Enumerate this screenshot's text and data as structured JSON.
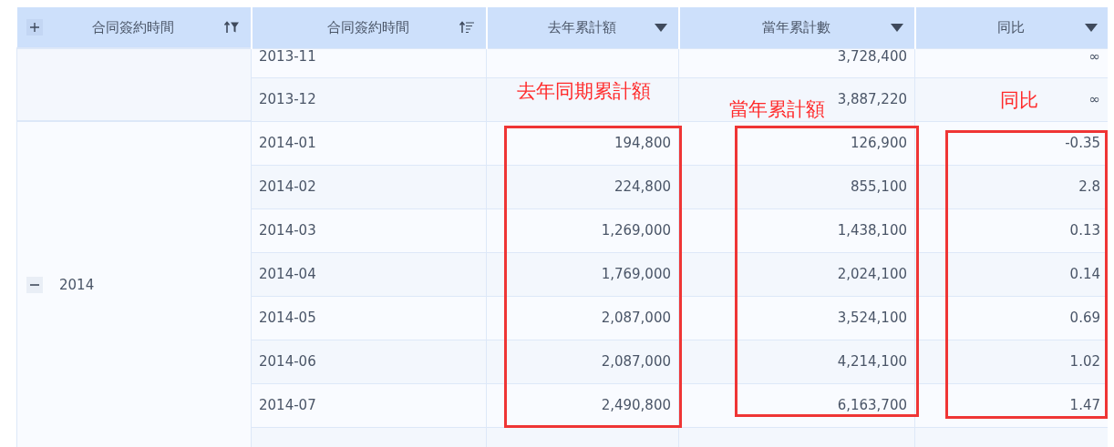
{
  "header": {
    "columns": [
      {
        "label": "合同簽約時間",
        "kind": "sort-filter"
      },
      {
        "label": "合同簽約時間",
        "kind": "sort"
      },
      {
        "label": "去年累計額",
        "kind": "dropdown"
      },
      {
        "label": "當年累計數",
        "kind": "dropdown"
      },
      {
        "label": "同比",
        "kind": "dropdown"
      }
    ]
  },
  "groups": [
    {
      "rows": [
        {
          "month": "2013-11",
          "this_year": "3,728,400",
          "yoy": "∞"
        },
        {
          "month": "2013-12",
          "this_year": "3,887,220",
          "yoy": "∞"
        }
      ]
    },
    {
      "label": "2014",
      "expanded": true,
      "rows": [
        {
          "month": "2014-01",
          "last_year": "194,800",
          "this_year": "126,900",
          "yoy": "-0.35"
        },
        {
          "month": "2014-02",
          "last_year": "224,800",
          "this_year": "855,100",
          "yoy": "2.8"
        },
        {
          "month": "2014-03",
          "last_year": "1,269,000",
          "this_year": "1,438,100",
          "yoy": "0.13"
        },
        {
          "month": "2014-04",
          "last_year": "1,769,000",
          "this_year": "2,024,100",
          "yoy": "0.14"
        },
        {
          "month": "2014-05",
          "last_year": "2,087,000",
          "this_year": "3,524,100",
          "yoy": "0.69"
        },
        {
          "month": "2014-06",
          "last_year": "2,087,000",
          "this_year": "4,214,100",
          "yoy": "1.02"
        },
        {
          "month": "2014-07",
          "last_year": "2,490,800",
          "this_year": "6,163,700",
          "yoy": "1.47"
        }
      ]
    }
  ],
  "annotations": [
    {
      "label": "去年同期累計額"
    },
    {
      "label": "當年累計額"
    },
    {
      "label": "同比"
    }
  ]
}
